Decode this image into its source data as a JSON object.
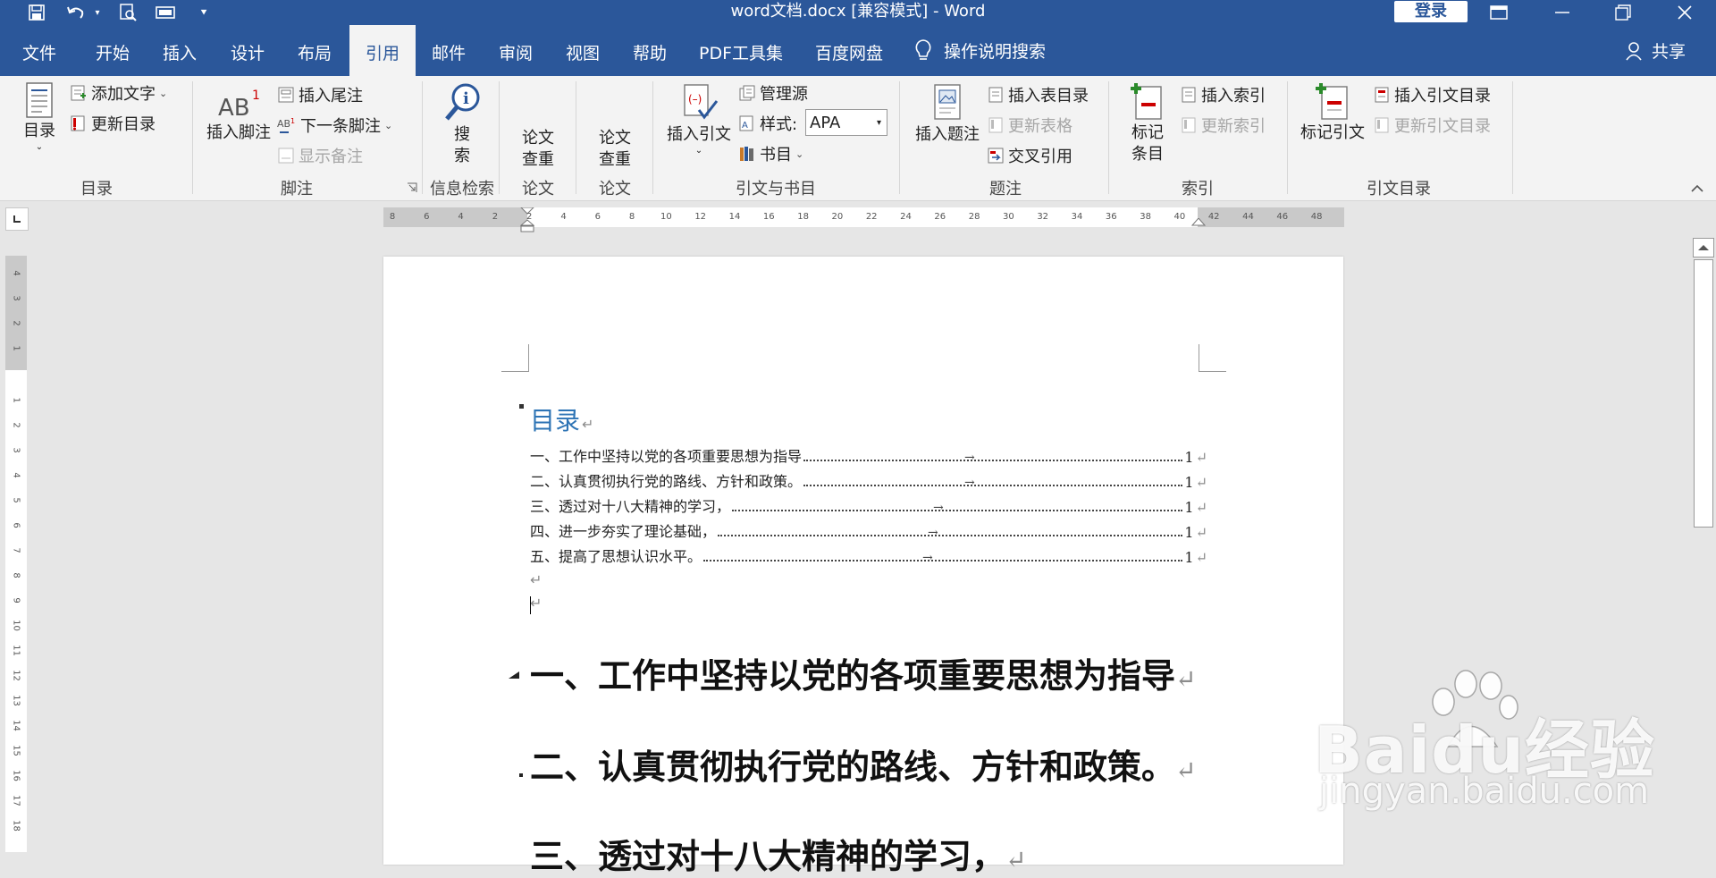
{
  "titlebar": {
    "title": "word文档.docx [兼容模式]  -  Word",
    "login": "登录"
  },
  "tabs": [
    "文件",
    "开始",
    "插入",
    "设计",
    "布局",
    "引用",
    "邮件",
    "审阅",
    "视图",
    "帮助",
    "PDF工具集",
    "百度网盘"
  ],
  "active_tab": "引用",
  "tell_me": "操作说明搜索",
  "share": "共享",
  "ribbon": {
    "toc_group": {
      "label": "目录",
      "toc": "目录",
      "add_text": "添加文字",
      "update_toc": "更新目录"
    },
    "footnote_group": {
      "label": "脚注",
      "insert_footnote": "插入脚注",
      "insert_endnote": "插入尾注",
      "next_footnote": "下一条脚注",
      "show_notes": "显示备注"
    },
    "research_group": {
      "label": "信息检索",
      "search_l1": "搜",
      "search_l2": "索"
    },
    "paper1_group": {
      "label": "论文",
      "l1": "论文",
      "l2": "查重"
    },
    "paper2_group": {
      "label": "论文",
      "l1": "论文",
      "l2": "查重"
    },
    "citation_group": {
      "label": "引文与书目",
      "insert_citation": "插入引文",
      "manage_sources": "管理源",
      "style_label": "样式:",
      "style_value": "APA",
      "bibliography": "书目"
    },
    "caption_group": {
      "label": "题注",
      "insert_caption": "插入题注",
      "insert_tof": "插入表目录",
      "update_table": "更新表格",
      "cross_ref": "交叉引用"
    },
    "index_group": {
      "label": "索引",
      "mark_entry_l1": "标记",
      "mark_entry_l2": "条目",
      "insert_index": "插入索引",
      "update_index": "更新索引"
    },
    "toa_group": {
      "label": "引文目录",
      "mark_citation": "标记引文",
      "insert_toa": "插入引文目录",
      "update_toa": "更新引文目录"
    }
  },
  "ruler": {
    "labels": [
      "8",
      "6",
      "4",
      "2",
      "2",
      "4",
      "6",
      "8",
      "10",
      "12",
      "14",
      "16",
      "18",
      "20",
      "22",
      "24",
      "26",
      "28",
      "30",
      "32",
      "34",
      "36",
      "38",
      "40",
      "42",
      "44",
      "46",
      "48"
    ],
    "vlabels": [
      "4",
      "3",
      "2",
      "1",
      "1",
      "2",
      "3",
      "4",
      "5",
      "6",
      "7",
      "8",
      "9",
      "10",
      "11",
      "12",
      "13",
      "14",
      "15",
      "16",
      "17",
      "18"
    ]
  },
  "document": {
    "toc_title": "目录",
    "toc_entries": [
      {
        "text": "一、工作中坚持以党的各项重要思想为指导",
        "page": "1"
      },
      {
        "text": "二、认真贯彻执行党的路线、方针和政策。",
        "page": "1"
      },
      {
        "text": "三、透过对十八大精神的学习，",
        "page": "1"
      },
      {
        "text": "四、进一步夯实了理论基础，",
        "page": "1"
      },
      {
        "text": "五、提高了思想认识水平。",
        "page": "1"
      }
    ],
    "headings": [
      "一、工作中坚持以党的各项重要思想为指导",
      "二、认真贯彻执行党的路线、方针和政策。",
      "三、透过对十八大精神的学习，"
    ],
    "para_mark": "↵"
  },
  "watermark": {
    "logo": "Baidu经验",
    "url": "jingyan.baidu.com"
  }
}
